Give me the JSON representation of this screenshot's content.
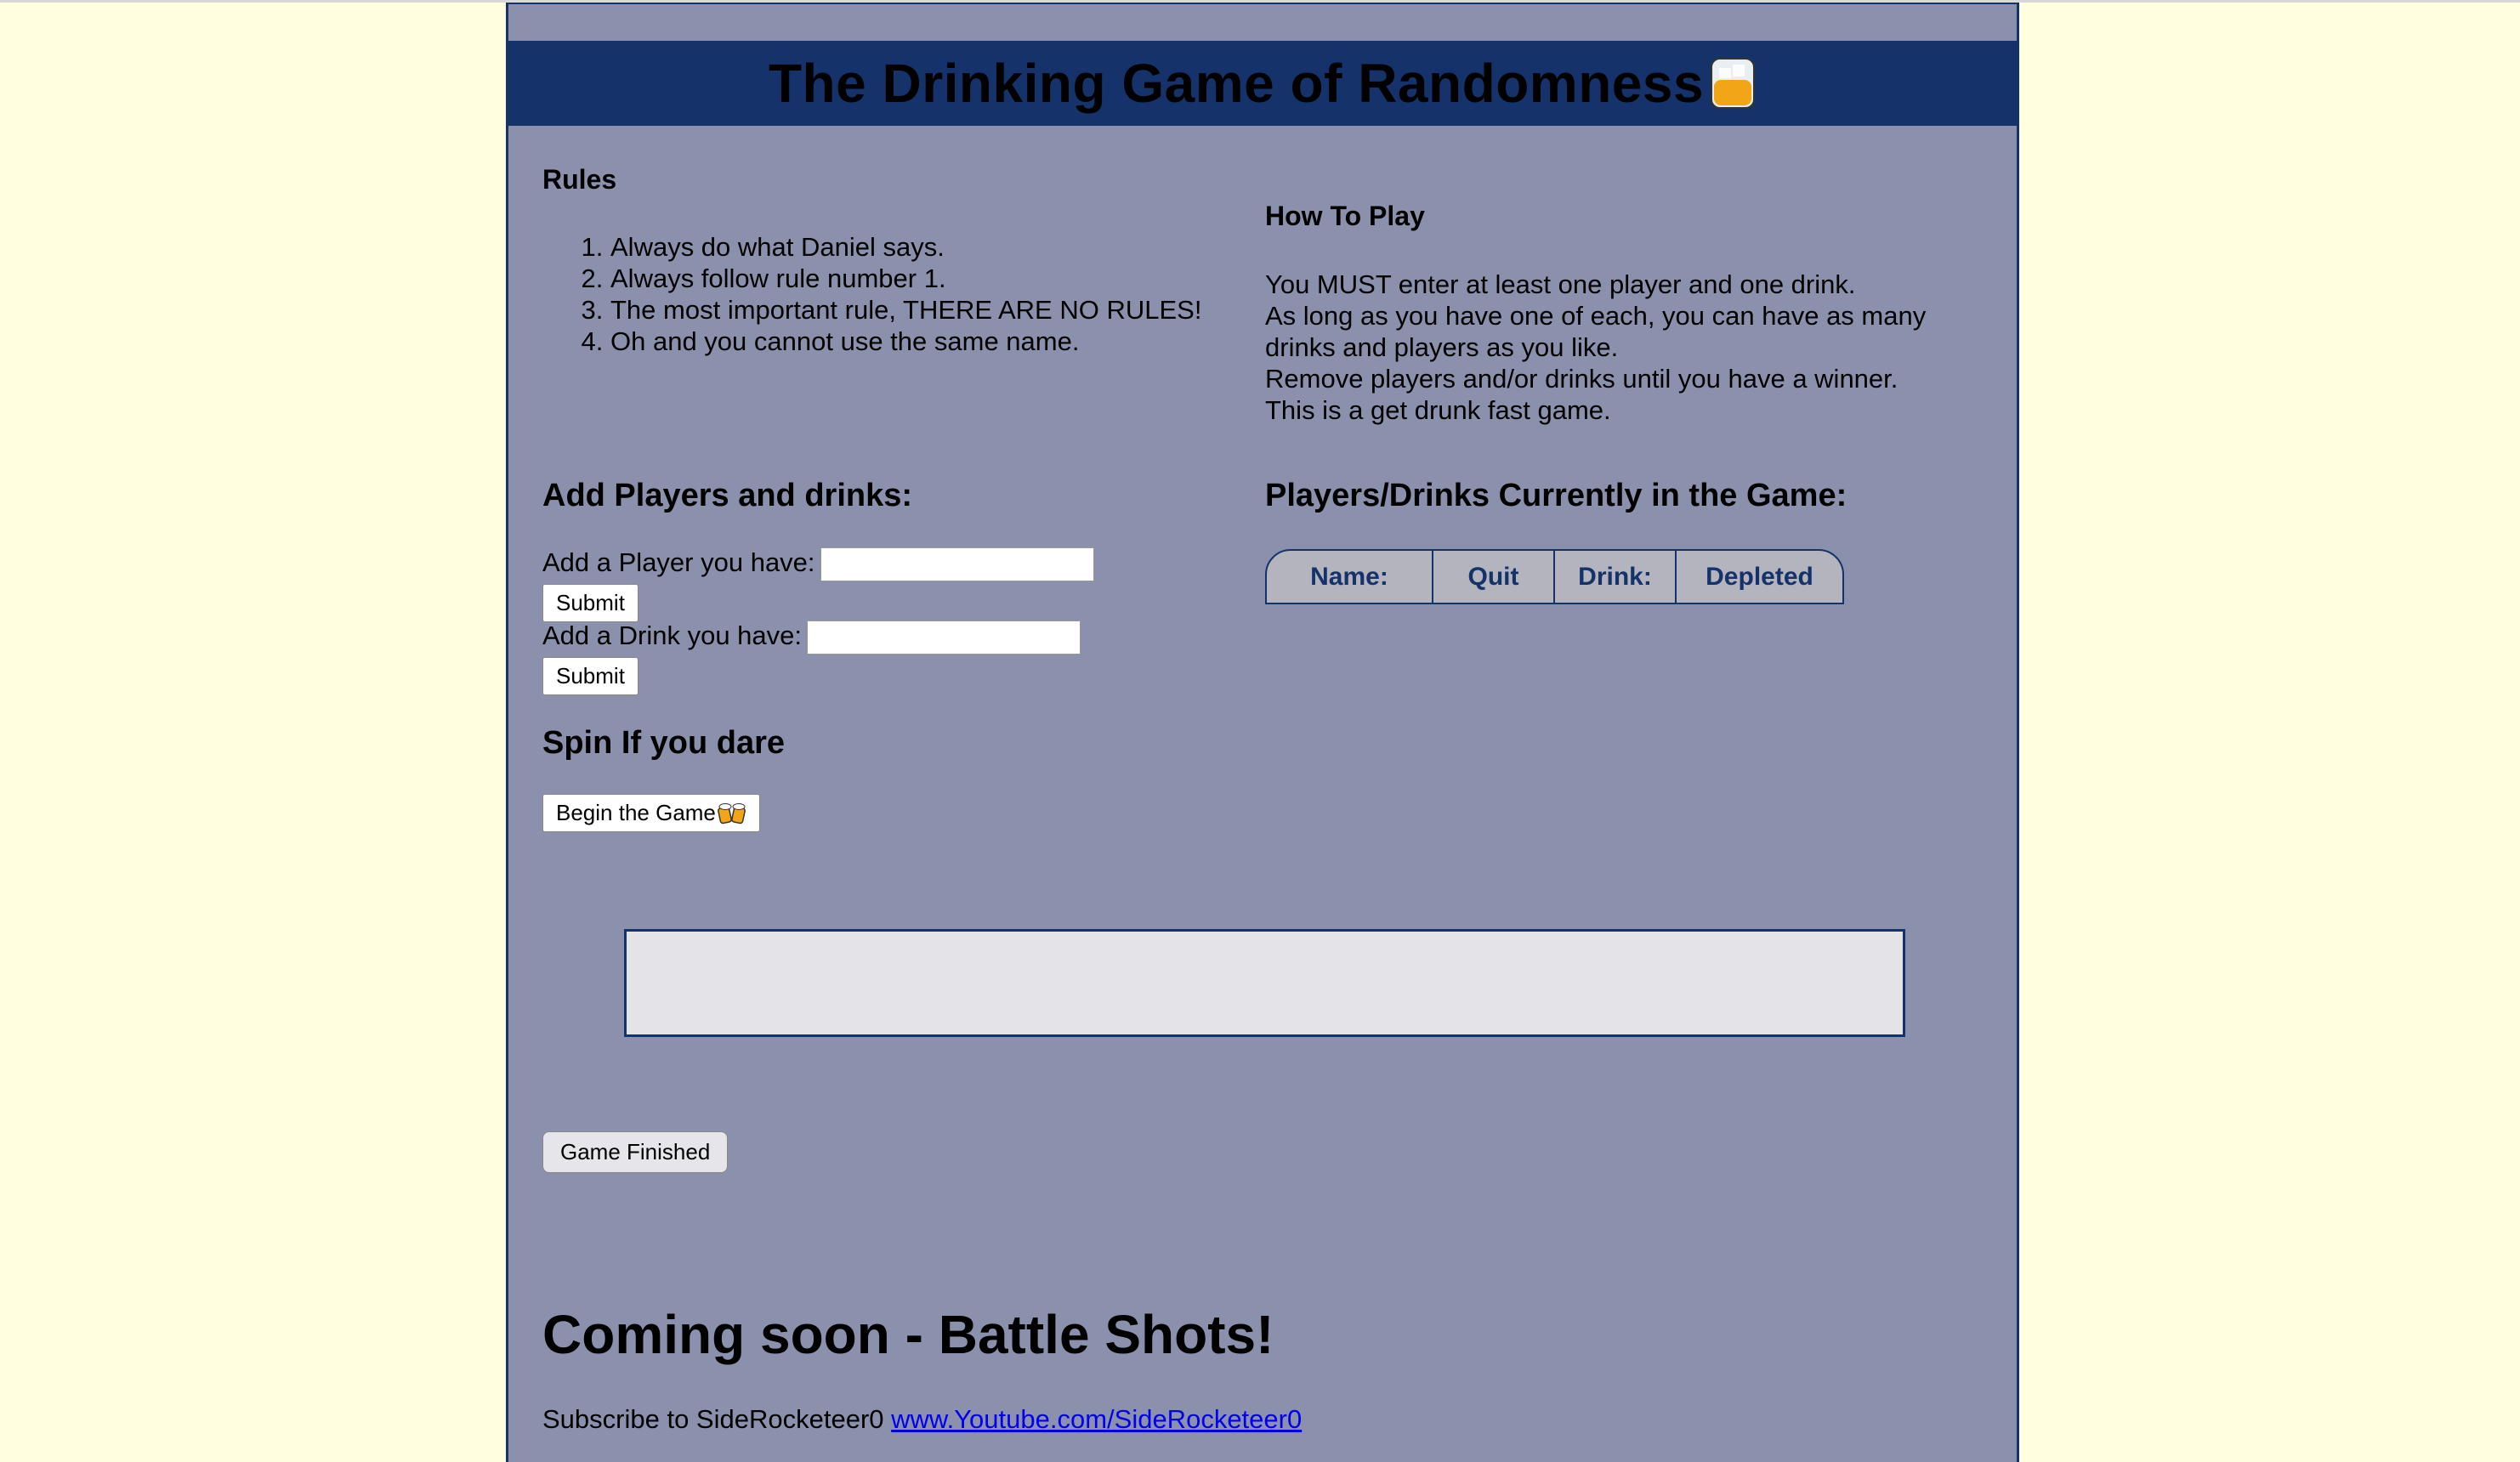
{
  "header": {
    "title": "The Drinking Game of Randomness"
  },
  "rules": {
    "heading": "Rules",
    "items": [
      "Always do what Daniel says.",
      "Always follow rule number 1.",
      "The most important rule, THERE ARE NO RULES!",
      "Oh and you cannot use the same name."
    ]
  },
  "how_to_play": {
    "heading": "How To Play",
    "lines": [
      "You MUST enter at least one player and one drink.",
      "As long as you have one of each, you can have as many",
      "drinks and players as you like.",
      "Remove players and/or drinks until you have a winner.",
      "This is a get drunk fast game."
    ]
  },
  "add_section": {
    "heading": "Add Players and drinks:",
    "player_label": "Add a Player you have:",
    "player_value": "",
    "drink_label": "Add a Drink you have:",
    "drink_value": "",
    "submit_label": "Submit"
  },
  "current": {
    "heading": "Players/Drinks Currently in the Game:",
    "columns": [
      "Name:",
      "Quit",
      "Drink:",
      "Depleted"
    ]
  },
  "spin": {
    "heading": "Spin If you dare",
    "begin_label": "Begin the Game"
  },
  "result": {
    "text": ""
  },
  "finish": {
    "label": "Game Finished"
  },
  "coming_soon": {
    "heading": "Coming soon - Battle Shots!"
  },
  "footer": {
    "text": "Subscribe to SideRocketeer0",
    "link_text": "www.Youtube.com/SideRocketeer0"
  },
  "icons": {
    "title_icon": "whisky-glass-icon",
    "begin_icon": "beer-cheers-icon"
  },
  "colors": {
    "page_bg": "#ffffe0",
    "panel_bg": "#8b91ad",
    "accent": "#15326a",
    "link": "#0000ee"
  }
}
